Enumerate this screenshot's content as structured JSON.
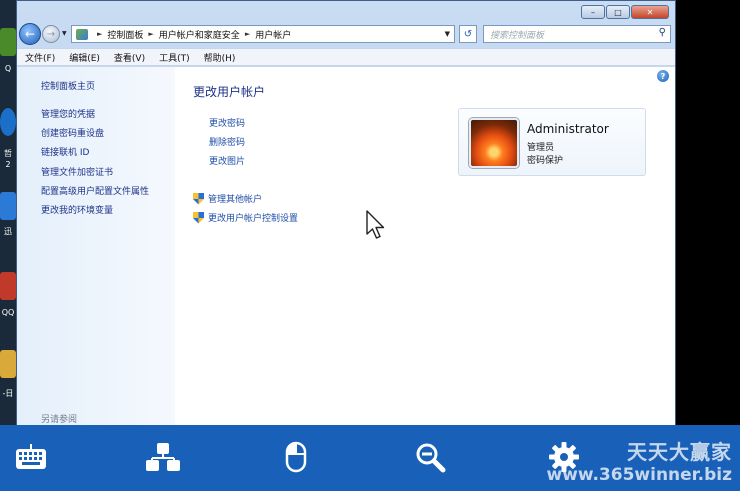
{
  "desktop": {
    "labels": [
      "Q",
      "哲",
      "2",
      "迅",
      "QQ",
      "-日"
    ]
  },
  "window": {
    "breadcrumb": [
      "控制面板",
      "用户帐户和家庭安全",
      "用户帐户"
    ],
    "search_placeholder": "搜索控制面板",
    "menu": [
      "文件(F)",
      "编辑(E)",
      "查看(V)",
      "工具(T)",
      "帮助(H)"
    ]
  },
  "sidebar": {
    "home": "控制面板主页",
    "links": [
      "管理您的凭据",
      "创建密码重设盘",
      "链接联机 ID",
      "管理文件加密证书",
      "配置高级用户配置文件属性",
      "更改我的环境变量"
    ],
    "see_also": "另请参阅"
  },
  "main": {
    "title": "更改用户帐户",
    "tasks": [
      "更改密码",
      "删除密码",
      "更改图片"
    ],
    "shield_links": [
      "管理其他帐户",
      "更改用户帐户控制设置"
    ],
    "account": {
      "name": "Administrator",
      "role": "管理员",
      "status": "密码保护"
    }
  },
  "toolbar": {
    "buttons": [
      "keyboard-icon",
      "network-icon",
      "mouse-icon",
      "zoom-out-icon",
      "settings-icon"
    ]
  },
  "watermark": {
    "cn": "天天大赢家",
    "url": "www.365winner.biz"
  },
  "colors": {
    "toolbar": "#1860b8",
    "link": "#1e4ea8",
    "title": "#1e3287"
  }
}
